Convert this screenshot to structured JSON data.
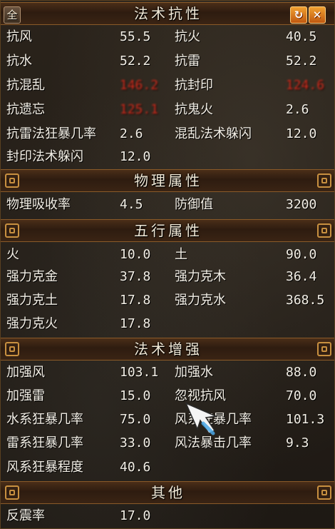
{
  "window": {
    "full_label": "全",
    "refresh_icon": "refresh-icon",
    "close_icon": "close-icon"
  },
  "sections": {
    "magic_resist": {
      "title": "法术抗性",
      "rows": [
        {
          "n1": "抗风",
          "v1": "55.5",
          "n2": "抗火",
          "v2": "40.5"
        },
        {
          "n1": "抗水",
          "v1": "52.2",
          "n2": "抗雷",
          "v2": "52.2"
        },
        {
          "n1": "抗混乱",
          "v1": "146.2",
          "n2": "抗封印",
          "v2": "124.6"
        },
        {
          "n1": "抗遗忘",
          "v1": "125.1",
          "n2": "抗鬼火",
          "v2": "2.6"
        },
        {
          "n1": "抗雷法狂暴几率",
          "v1": "2.6",
          "n2": "混乱法术躲闪",
          "v2": "12.0"
        },
        {
          "n1": "封印法术躲闪",
          "v1": "12.0",
          "n2": "",
          "v2": ""
        }
      ]
    },
    "physical": {
      "title": "物理属性",
      "rows": [
        {
          "n1": "物理吸收率",
          "v1": "4.5",
          "n2": "防御值",
          "v2": "3200"
        }
      ]
    },
    "five_elements": {
      "title": "五行属性",
      "rows": [
        {
          "n1": "火",
          "v1": "10.0",
          "n2": "土",
          "v2": "90.0"
        },
        {
          "n1": "强力克金",
          "v1": "37.8",
          "n2": "强力克木",
          "v2": "36.4"
        },
        {
          "n1": "强力克土",
          "v1": "17.8",
          "n2": "强力克水",
          "v2": "368.5"
        },
        {
          "n1": "强力克火",
          "v1": "17.8",
          "n2": "",
          "v2": ""
        }
      ]
    },
    "magic_boost": {
      "title": "法术增强",
      "rows": [
        {
          "n1": "加强风",
          "v1": "103.1",
          "n2": "加强水",
          "v2": "88.0"
        },
        {
          "n1": "加强雷",
          "v1": "15.0",
          "n2": "忽视抗风",
          "v2": "70.0"
        },
        {
          "n1": "水系狂暴几率",
          "v1": "75.0",
          "n2": "风系狂暴几率",
          "v2": "101.3"
        },
        {
          "n1": "雷系狂暴几率",
          "v1": "33.0",
          "n2": "风法暴击几率",
          "v2": "9.3"
        },
        {
          "n1": "风系狂暴程度",
          "v1": "40.6",
          "n2": "",
          "v2": ""
        }
      ]
    },
    "other": {
      "title": "其他",
      "rows": [
        {
          "n1": "反震率",
          "v1": "17.0",
          "n2": "",
          "v2": ""
        }
      ]
    }
  },
  "colors": {
    "text": "#f3efe6",
    "highlight_red": "#e23020",
    "header_border": "#8a5a28",
    "ornament": "#c89040",
    "button_orange": "#f0a030"
  }
}
